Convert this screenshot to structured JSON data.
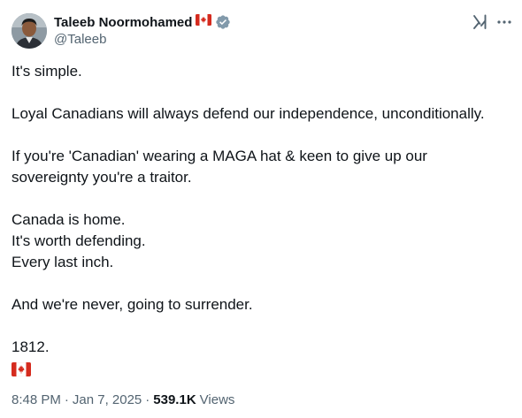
{
  "author": {
    "display_name": "Taleeb Noormohamed",
    "handle": "@Taleeb",
    "name_emoji": "canada-flag-icon",
    "verified": true,
    "verified_color": "#829aab"
  },
  "actions": {
    "grok_icon": "grok-icon",
    "more_icon": "more-icon"
  },
  "tweet": {
    "lines": [
      "It's simple.",
      "",
      "Loyal Canadians will always defend our independence, unconditionally.",
      "",
      "If you're 'Canadian' wearing a MAGA hat & keen to give up our",
      "sovereignty you're a traitor.",
      "",
      "Canada is home.",
      "It's worth defending.",
      "Every last inch.",
      "",
      "And we're never, going to surrender.",
      "",
      "1812."
    ],
    "trailing_emoji": "canada-flag-icon"
  },
  "meta": {
    "time": "8:48 PM",
    "separator1": "·",
    "date": "Jan 7, 2025",
    "separator2": "·",
    "views_count": "539.1K",
    "views_label": "Views"
  },
  "colors": {
    "text": "#0f1419",
    "secondary": "#536471",
    "flag_red": "#d52b1e"
  }
}
